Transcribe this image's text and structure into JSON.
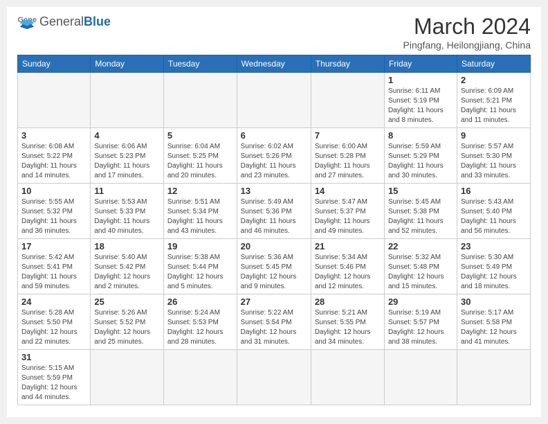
{
  "header": {
    "logo_general": "General",
    "logo_blue": "Blue",
    "title": "March 2024",
    "subtitle": "Pingfang, Heilongjiang, China"
  },
  "days_of_week": [
    "Sunday",
    "Monday",
    "Tuesday",
    "Wednesday",
    "Thursday",
    "Friday",
    "Saturday"
  ],
  "weeks": [
    [
      {
        "day": "",
        "info": ""
      },
      {
        "day": "",
        "info": ""
      },
      {
        "day": "",
        "info": ""
      },
      {
        "day": "",
        "info": ""
      },
      {
        "day": "",
        "info": ""
      },
      {
        "day": "1",
        "info": "Sunrise: 6:11 AM\nSunset: 5:19 PM\nDaylight: 11 hours\nand 8 minutes."
      },
      {
        "day": "2",
        "info": "Sunrise: 6:09 AM\nSunset: 5:21 PM\nDaylight: 11 hours\nand 11 minutes."
      }
    ],
    [
      {
        "day": "3",
        "info": "Sunrise: 6:08 AM\nSunset: 5:22 PM\nDaylight: 11 hours\nand 14 minutes."
      },
      {
        "day": "4",
        "info": "Sunrise: 6:06 AM\nSunset: 5:23 PM\nDaylight: 11 hours\nand 17 minutes."
      },
      {
        "day": "5",
        "info": "Sunrise: 6:04 AM\nSunset: 5:25 PM\nDaylight: 11 hours\nand 20 minutes."
      },
      {
        "day": "6",
        "info": "Sunrise: 6:02 AM\nSunset: 5:26 PM\nDaylight: 11 hours\nand 23 minutes."
      },
      {
        "day": "7",
        "info": "Sunrise: 6:00 AM\nSunset: 5:28 PM\nDaylight: 11 hours\nand 27 minutes."
      },
      {
        "day": "8",
        "info": "Sunrise: 5:59 AM\nSunset: 5:29 PM\nDaylight: 11 hours\nand 30 minutes."
      },
      {
        "day": "9",
        "info": "Sunrise: 5:57 AM\nSunset: 5:30 PM\nDaylight: 11 hours\nand 33 minutes."
      }
    ],
    [
      {
        "day": "10",
        "info": "Sunrise: 5:55 AM\nSunset: 5:32 PM\nDaylight: 11 hours\nand 36 minutes."
      },
      {
        "day": "11",
        "info": "Sunrise: 5:53 AM\nSunset: 5:33 PM\nDaylight: 11 hours\nand 40 minutes."
      },
      {
        "day": "12",
        "info": "Sunrise: 5:51 AM\nSunset: 5:34 PM\nDaylight: 11 hours\nand 43 minutes."
      },
      {
        "day": "13",
        "info": "Sunrise: 5:49 AM\nSunset: 5:36 PM\nDaylight: 11 hours\nand 46 minutes."
      },
      {
        "day": "14",
        "info": "Sunrise: 5:47 AM\nSunset: 5:37 PM\nDaylight: 11 hours\nand 49 minutes."
      },
      {
        "day": "15",
        "info": "Sunrise: 5:45 AM\nSunset: 5:38 PM\nDaylight: 11 hours\nand 52 minutes."
      },
      {
        "day": "16",
        "info": "Sunrise: 5:43 AM\nSunset: 5:40 PM\nDaylight: 11 hours\nand 56 minutes."
      }
    ],
    [
      {
        "day": "17",
        "info": "Sunrise: 5:42 AM\nSunset: 5:41 PM\nDaylight: 11 hours\nand 59 minutes."
      },
      {
        "day": "18",
        "info": "Sunrise: 5:40 AM\nSunset: 5:42 PM\nDaylight: 12 hours\nand 2 minutes."
      },
      {
        "day": "19",
        "info": "Sunrise: 5:38 AM\nSunset: 5:44 PM\nDaylight: 12 hours\nand 5 minutes."
      },
      {
        "day": "20",
        "info": "Sunrise: 5:36 AM\nSunset: 5:45 PM\nDaylight: 12 hours\nand 9 minutes."
      },
      {
        "day": "21",
        "info": "Sunrise: 5:34 AM\nSunset: 5:46 PM\nDaylight: 12 hours\nand 12 minutes."
      },
      {
        "day": "22",
        "info": "Sunrise: 5:32 AM\nSunset: 5:48 PM\nDaylight: 12 hours\nand 15 minutes."
      },
      {
        "day": "23",
        "info": "Sunrise: 5:30 AM\nSunset: 5:49 PM\nDaylight: 12 hours\nand 18 minutes."
      }
    ],
    [
      {
        "day": "24",
        "info": "Sunrise: 5:28 AM\nSunset: 5:50 PM\nDaylight: 12 hours\nand 22 minutes."
      },
      {
        "day": "25",
        "info": "Sunrise: 5:26 AM\nSunset: 5:52 PM\nDaylight: 12 hours\nand 25 minutes."
      },
      {
        "day": "26",
        "info": "Sunrise: 5:24 AM\nSunset: 5:53 PM\nDaylight: 12 hours\nand 28 minutes."
      },
      {
        "day": "27",
        "info": "Sunrise: 5:22 AM\nSunset: 5:54 PM\nDaylight: 12 hours\nand 31 minutes."
      },
      {
        "day": "28",
        "info": "Sunrise: 5:21 AM\nSunset: 5:55 PM\nDaylight: 12 hours\nand 34 minutes."
      },
      {
        "day": "29",
        "info": "Sunrise: 5:19 AM\nSunset: 5:57 PM\nDaylight: 12 hours\nand 38 minutes."
      },
      {
        "day": "30",
        "info": "Sunrise: 5:17 AM\nSunset: 5:58 PM\nDaylight: 12 hours\nand 41 minutes."
      }
    ],
    [
      {
        "day": "31",
        "info": "Sunrise: 5:15 AM\nSunset: 5:59 PM\nDaylight: 12 hours\nand 44 minutes."
      },
      {
        "day": "",
        "info": ""
      },
      {
        "day": "",
        "info": ""
      },
      {
        "day": "",
        "info": ""
      },
      {
        "day": "",
        "info": ""
      },
      {
        "day": "",
        "info": ""
      },
      {
        "day": "",
        "info": ""
      }
    ]
  ]
}
